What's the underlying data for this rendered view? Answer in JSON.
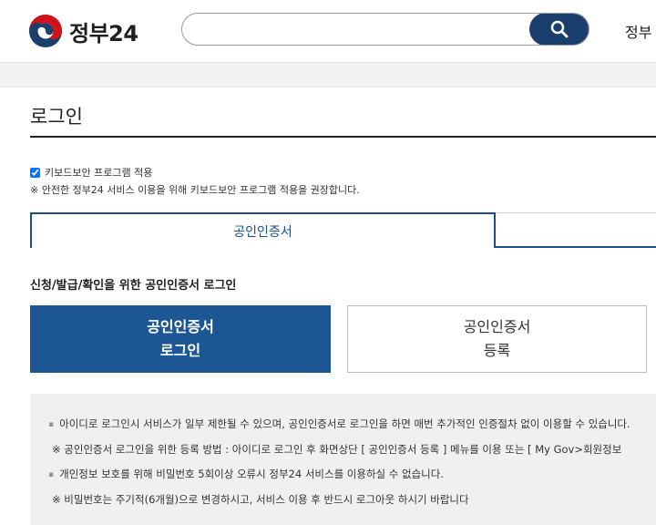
{
  "header": {
    "logo_text": "정부24",
    "search_value": "",
    "nav_gov": "정부"
  },
  "page": {
    "title": "로그인"
  },
  "keyboard_security": {
    "checkbox_label": "키보드보안 프로그램 적용",
    "checked": true,
    "note": "※ 안전한 정부24 서비스 이용을 위해 키보드보안 프로그램 적용을 권장합니다."
  },
  "tabs": [
    {
      "label": "공인인증서",
      "active": true
    },
    {
      "label": "",
      "active": false
    }
  ],
  "section_title": "신청/발급/확인을 위한 공인인증서 로그인",
  "buttons": {
    "login_line1": "공인인증서",
    "login_line2": "로그인",
    "register_line1": "공인인증서",
    "register_line2": "등록"
  },
  "notices": [
    "아이디로 로그인시 서비스가 일부 제한될 수 있으며, 공인인증서로 로그인을 하면 매번 추가적인 인증절차 없이 이용할 수 있습니다.",
    "※ 공인인증서 로그인을 위한 등록 방법 : 아이디로 로그인 후 화면상단 [ 공인인증서 등록 ] 메뉴를 이용 또는 [ My Gov>회원정보",
    "개인정보 보호를 위해 비밀번호 5회이상 오류시 정부24 서비스를 이용하실 수 없습니다.",
    "※ 비밀번호는 주기적(6개월)으로 변경하시고, 서비스 이용 후 반드시 로그아웃 하시기 바랍니다"
  ],
  "colors": {
    "primary": "#1d5694",
    "search_button": "#1a3e6e",
    "tab_border": "#1a4f8c",
    "notice_bg": "#f0f0f0"
  }
}
